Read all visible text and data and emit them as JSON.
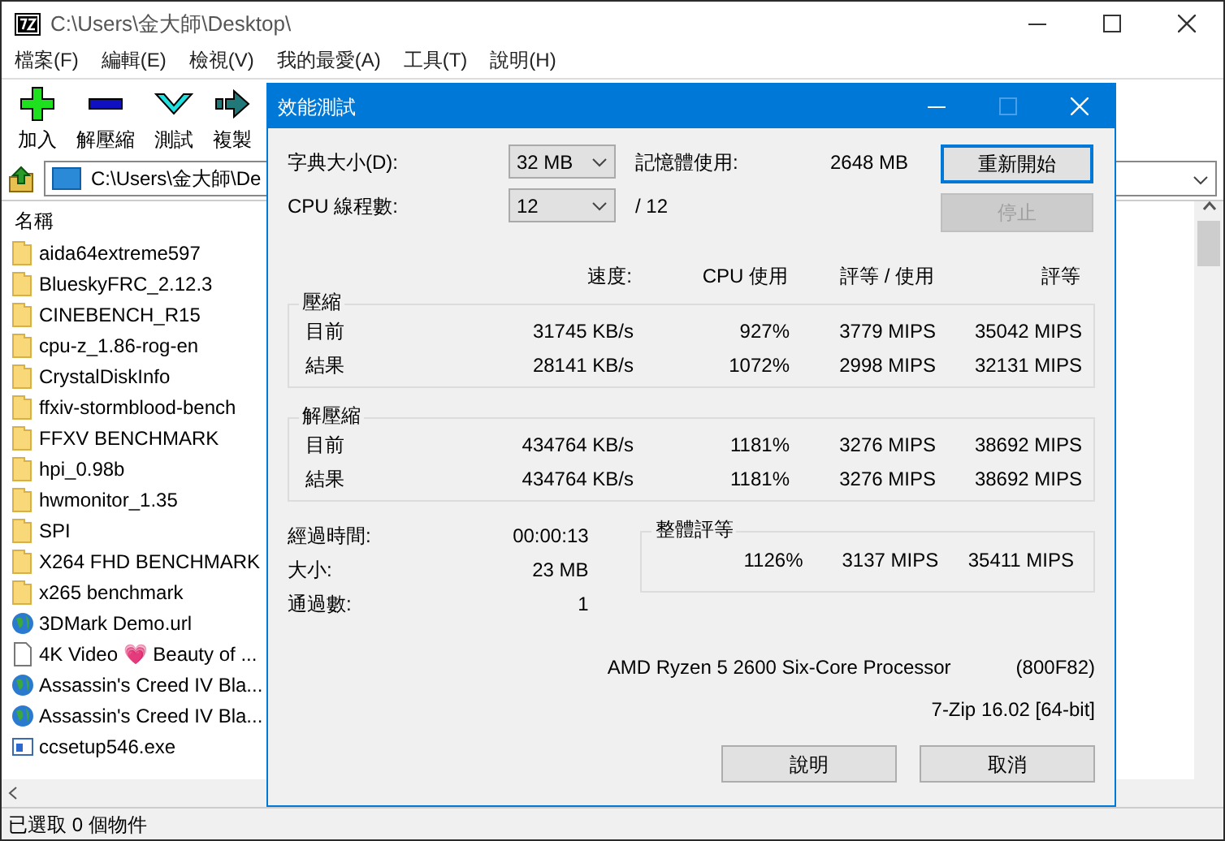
{
  "window": {
    "title": "C:\\Users\\金大師\\Desktop\\"
  },
  "menu": [
    "檔案(F)",
    "編輯(E)",
    "檢視(V)",
    "我的最愛(A)",
    "工具(T)",
    "說明(H)"
  ],
  "toolbar": [
    {
      "label": "加入",
      "kind": "add"
    },
    {
      "label": "解壓縮",
      "kind": "extract"
    },
    {
      "label": "測試",
      "kind": "test"
    },
    {
      "label": "複製",
      "kind": "copy"
    }
  ],
  "address": {
    "value": "C:\\Users\\金大師\\De"
  },
  "file_list": {
    "header": "名稱",
    "items": [
      {
        "name": "aida64extreme597",
        "kind": "folder"
      },
      {
        "name": "BlueskyFRC_2.12.3",
        "kind": "folder"
      },
      {
        "name": "CINEBENCH_R15",
        "kind": "folder"
      },
      {
        "name": "cpu-z_1.86-rog-en",
        "kind": "folder"
      },
      {
        "name": "CrystalDiskInfo",
        "kind": "folder"
      },
      {
        "name": "ffxiv-stormblood-bench",
        "kind": "folder"
      },
      {
        "name": "FFXV BENCHMARK",
        "kind": "folder"
      },
      {
        "name": "hpi_0.98b",
        "kind": "folder"
      },
      {
        "name": "hwmonitor_1.35",
        "kind": "folder"
      },
      {
        "name": "SPI",
        "kind": "folder"
      },
      {
        "name": "X264 FHD BENCHMARK",
        "kind": "folder"
      },
      {
        "name": "x265 benchmark",
        "kind": "folder"
      },
      {
        "name": "3DMark Demo.url",
        "kind": "url"
      },
      {
        "name": "4K Video 💗 Beauty of ...",
        "kind": "file"
      },
      {
        "name": "Assassin's Creed IV Bla...",
        "kind": "url"
      },
      {
        "name": "Assassin's Creed IV Bla...",
        "kind": "url"
      },
      {
        "name": "ccsetup546.exe",
        "kind": "exe"
      }
    ]
  },
  "status_bar": "已選取 0 個物件",
  "dialog": {
    "title": "效能測試",
    "dictionary": {
      "label": "字典大小(D):",
      "value": "32 MB"
    },
    "memory": {
      "label": "記憶體使用:",
      "value": "2648 MB"
    },
    "threads": {
      "label": "CPU 線程數:",
      "value": "12",
      "total": "/ 12"
    },
    "side_buttons": [
      {
        "label": "重新開始",
        "disabled": false,
        "focused": true
      },
      {
        "label": "停止",
        "disabled": true,
        "focused": false
      }
    ],
    "columns": [
      "速度:",
      "CPU 使用",
      "評等 / 使用",
      "評等"
    ],
    "sections": [
      {
        "title": "壓縮",
        "rows": [
          {
            "label": "目前",
            "speed": "31745 KB/s",
            "cpu": "927%",
            "rating_usage": "3779 MIPS",
            "rating": "35042 MIPS"
          },
          {
            "label": "結果",
            "speed": "28141 KB/s",
            "cpu": "1072%",
            "rating_usage": "2998 MIPS",
            "rating": "32131 MIPS"
          }
        ]
      },
      {
        "title": "解壓縮",
        "rows": [
          {
            "label": "目前",
            "speed": "434764 KB/s",
            "cpu": "1181%",
            "rating_usage": "3276 MIPS",
            "rating": "38692 MIPS"
          },
          {
            "label": "結果",
            "speed": "434764 KB/s",
            "cpu": "1181%",
            "rating_usage": "3276 MIPS",
            "rating": "38692 MIPS"
          }
        ]
      }
    ],
    "stats": [
      {
        "label": "經過時間:",
        "value": "00:00:13"
      },
      {
        "label": "大小:",
        "value": "23 MB"
      },
      {
        "label": "通過數:",
        "value": "1"
      }
    ],
    "overall": {
      "title": "整體評等",
      "cpu": "1126%",
      "rating_usage": "3137 MIPS",
      "rating": "35411 MIPS"
    },
    "cpu_name": "AMD Ryzen 5 2600 Six-Core Processor",
    "cpu_id": "(800F82)",
    "version": "7-Zip 16.02 [64-bit]",
    "bottom_buttons": [
      {
        "label": "說明",
        "disabled": false,
        "focused": false
      },
      {
        "label": "取消",
        "disabled": false,
        "focused": false
      }
    ]
  }
}
